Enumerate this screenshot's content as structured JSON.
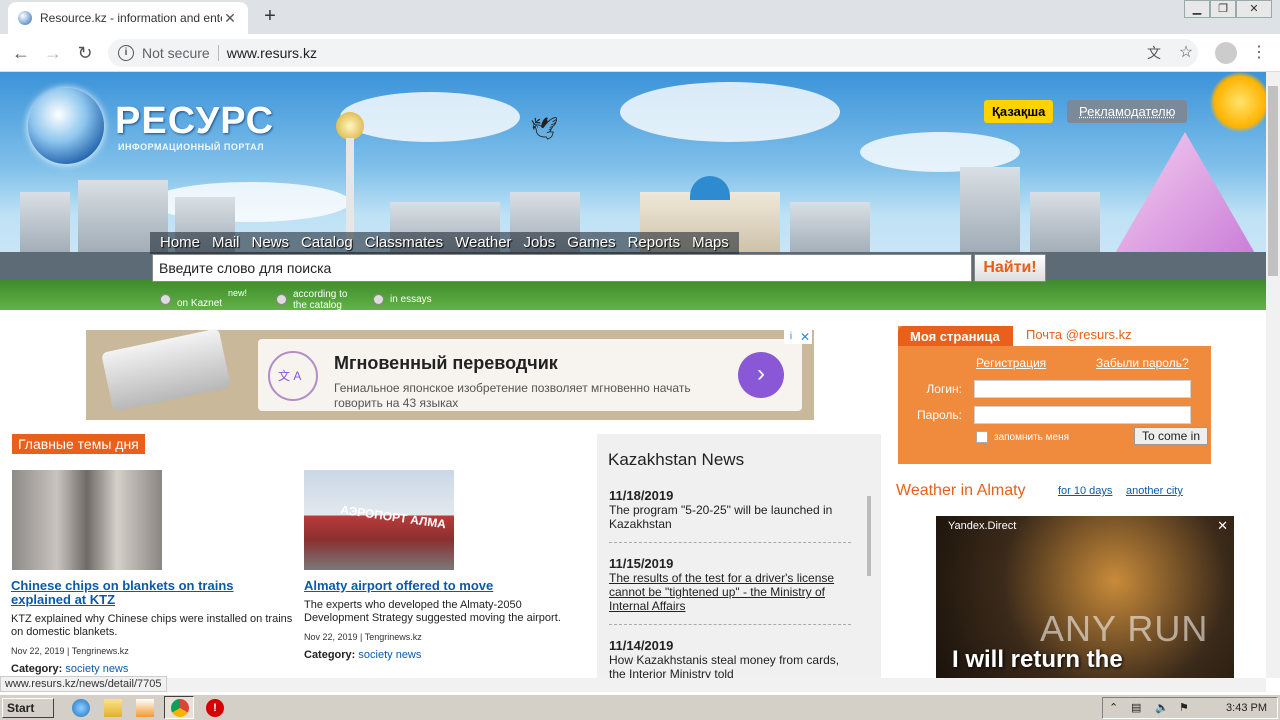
{
  "browser": {
    "tab_title": "Resource.kz - information and entertainment portal",
    "not_secure": "Not secure",
    "url": "www.resurs.kz",
    "new_tab_symbol": "+",
    "tab_close_symbol": "✕"
  },
  "header": {
    "logo_title": "РЕСУРС",
    "logo_subtitle": "ИНФОРМАЦИОННЫЙ ПОРТАЛ",
    "kazakh_button": "Қазақша",
    "advertiser_button": "Рекламодателю",
    "nav": [
      "Home",
      "Mail",
      "News",
      "Catalog",
      "Classmates",
      "Weather",
      "Jobs",
      "Games",
      "Reports",
      "Maps"
    ],
    "search_placeholder": "Введите слово для поиска",
    "search_button": "Найти!",
    "radio_kaznet": "on Kaznet",
    "new_tag": "new!",
    "radio_catalog": "according to the catalog",
    "radio_essays": "in essays"
  },
  "ad_banner": {
    "headline": "Мгновенный переводчик",
    "text": "Гениальное японское изобретение позволяет мгновенно начать говорить на 43 языках",
    "icon_letters": "文 A"
  },
  "main_topics": {
    "heading": "Главные темы дня",
    "category_label": "Category:",
    "items": [
      {
        "title": "Chinese chips on blankets on trains explained at KTZ",
        "desc": "KTZ explained why Chinese chips were installed on trains on domestic blankets.",
        "meta": "Nov 22, 2019 | Tengrinews.kz",
        "category": "society news"
      },
      {
        "title": "Almaty airport offered to move",
        "desc": "The experts who developed the Almaty-2050 Development Strategy suggested moving the airport.",
        "meta": "Nov 22, 2019 | Tengrinews.kz",
        "category": "society news",
        "image_text": "АЭРОПОРТ АЛМА"
      }
    ]
  },
  "kz_news": {
    "heading": "Kazakhstan News",
    "items": [
      {
        "date": "11/18/2019",
        "text": "The program \"5-20-25\" will be launched in Kazakhstan"
      },
      {
        "date": "11/15/2019",
        "text": "The results of the test for a driver's license cannot be \"tightened up\" - the Ministry of Internal Affairs"
      },
      {
        "date": "11/14/2019",
        "text": "How Kazakhstanis steal money from cards, the Interior Ministry told"
      }
    ]
  },
  "login": {
    "tab_my_page": "Моя страница",
    "tab_mail": "Почта @resurs.kz",
    "register": "Регистрация",
    "forgot": "Забыли пароль?",
    "login_label": "Логин:",
    "password_label": "Пароль:",
    "remember": "запомнить меня",
    "enter_button": "To come in"
  },
  "weather": {
    "title": "Weather in Almaty",
    "link_10days": "for 10 days",
    "link_other": "another city"
  },
  "yandex_ad": {
    "label": "Yandex.Direct",
    "caption": "I will return the",
    "watermark": "ANY RUN"
  },
  "status_url": "www.resurs.kz/news/detail/7705",
  "taskbar": {
    "start": "Start",
    "clock": "3:43 PM"
  }
}
